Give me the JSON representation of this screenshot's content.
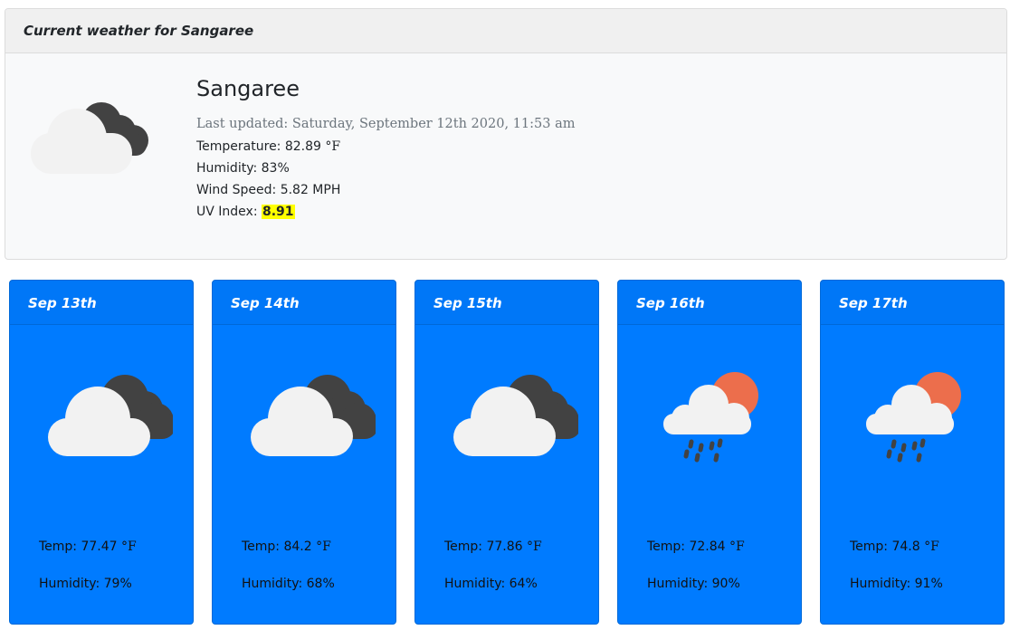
{
  "current": {
    "header": "Current weather for Sangaree",
    "icon": "cloudy-icon",
    "city": "Sangaree",
    "last_updated": "Last updated: Saturday, September 12th 2020, 11:53 am",
    "temperature_label": "Temperature: 82.89",
    "temperature_unit": " °F",
    "humidity": "Humidity: 83%",
    "wind_speed": "Wind Speed: 5.82 MPH",
    "uv_label": "UV Index: ",
    "uv_value": "8.91",
    "uv_highlight_color": "#ffff00"
  },
  "forecast": [
    {
      "date": "Sep 13th",
      "icon": "cloudy-icon",
      "temp": "Temp: 77.47",
      "unit": " °F",
      "humidity": "Humidity: 79%"
    },
    {
      "date": "Sep 14th",
      "icon": "cloudy-icon",
      "temp": "Temp: 84.2",
      "unit": " °F",
      "humidity": "Humidity: 68%"
    },
    {
      "date": "Sep 15th",
      "icon": "cloudy-icon",
      "temp": "Temp: 77.86",
      "unit": " °F",
      "humidity": "Humidity: 64%"
    },
    {
      "date": "Sep 16th",
      "icon": "sun-rain-icon",
      "temp": "Temp: 72.84",
      "unit": " °F",
      "humidity": "Humidity: 90%"
    },
    {
      "date": "Sep 17th",
      "icon": "sun-rain-icon",
      "temp": "Temp: 74.8",
      "unit": " °F",
      "humidity": "Humidity: 91%"
    }
  ],
  "colors": {
    "card_blue": "#007bff",
    "sun": "#ec6e4c",
    "cloud_dark": "#424242",
    "cloud_light": "#f2f2f2"
  }
}
